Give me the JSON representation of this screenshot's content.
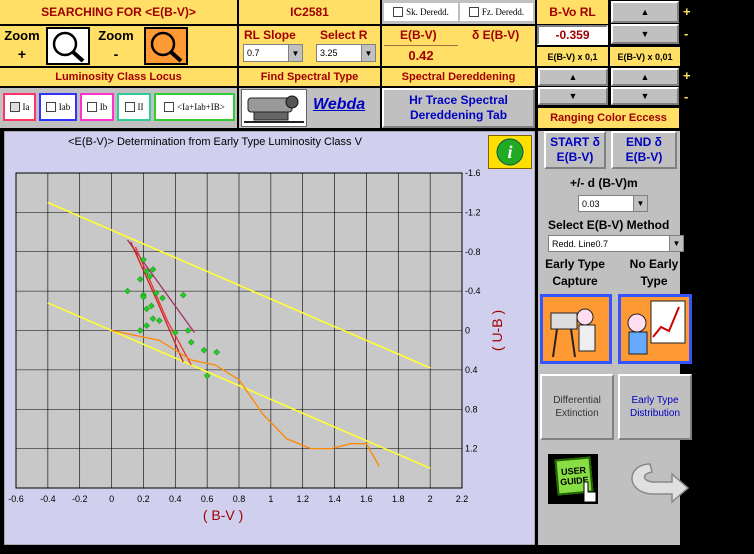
{
  "header": {
    "searching_for": "SEARCHING FOR  <E(B-V)>",
    "cluster": "IC2581",
    "sk_deredd": "Sk. Deredd.",
    "fz_deredd": "Fz. Deredd.",
    "bvo_rl": "B-Vo RL"
  },
  "zoom": {
    "zoom_plus_label": "Zoom",
    "zoom_plus_sign": "+",
    "zoom_minus_label": "Zoom",
    "zoom_minus_sign": "-"
  },
  "rl": {
    "slope_label": "RL Slope",
    "select_r_label": "Select R",
    "slope_value": "0.7",
    "r_value": "3.25"
  },
  "ebv": {
    "label": "E(B-V)",
    "delta_label": "δ E(B-V)",
    "value": "0.42",
    "bvo_value": "-0.359",
    "x01": "E(B-V) x 0,1",
    "x001": "E(B-V) x 0,01"
  },
  "sections": {
    "lum_locus": "Luminosity Class Locus",
    "find_spec": "Find Spectral Type",
    "spec_dered": "Spectral Dereddening",
    "ranging": "Ranging Color Eccess"
  },
  "lum_classes": [
    "Ia",
    "Iab",
    "Ib",
    "II",
    "<Ia+Iab+IB>"
  ],
  "webda": "Webda",
  "hr_trace": "Hr Trace Spectral Dereddening Tab",
  "start_btn": "START δ E(B-V)",
  "end_btn": "END δ E(B-V)",
  "pm_label": "+/- d (B-V)m",
  "pm_value": "0.03",
  "method_label": "Select E(B-V) Method",
  "method_value": "Redd. Line0.7",
  "early_capture": "Early Type Capture",
  "no_early": "No Early Type",
  "differential": "Differential Extinction",
  "early_dist": "Early Type Distribution",
  "user_guide": "USER GUIDE",
  "signs": {
    "plus": "+",
    "minus": "-"
  },
  "chart_data": {
    "type": "scatter",
    "title": "<E(B-V)> Determination from Early Type Luminosity Class V",
    "xlabel": "( B-V )",
    "ylabel": "( U-B )",
    "xlim": [
      -0.6,
      2.2
    ],
    "ylim": [
      1.6,
      -1.6
    ],
    "y_inverted": true,
    "xticks": [
      -0.6,
      -0.4,
      -0.2,
      0,
      0.2,
      0.4,
      0.6,
      0.8,
      1,
      1.2,
      1.4,
      1.6,
      1.8,
      2,
      2.2
    ],
    "yticks": [
      -1.6,
      -1.2,
      -0.8,
      -0.4,
      0,
      0.4,
      0.8,
      1.2
    ],
    "grid": true,
    "points": [
      [
        0.2,
        -0.72
      ],
      [
        0.22,
        -0.6
      ],
      [
        0.24,
        -0.55
      ],
      [
        0.18,
        -0.52
      ],
      [
        0.26,
        -0.62
      ],
      [
        0.1,
        -0.4
      ],
      [
        0.2,
        -0.36
      ],
      [
        0.28,
        -0.38
      ],
      [
        0.32,
        -0.33
      ],
      [
        0.45,
        -0.36
      ],
      [
        0.22,
        -0.22
      ],
      [
        0.26,
        -0.12
      ],
      [
        0.3,
        -0.1
      ],
      [
        0.22,
        -0.05
      ],
      [
        0.18,
        0.0
      ],
      [
        0.4,
        0.02
      ],
      [
        0.48,
        0.0
      ],
      [
        0.5,
        0.12
      ],
      [
        0.58,
        0.2
      ],
      [
        0.66,
        0.22
      ],
      [
        0.6,
        0.46
      ],
      [
        0.2,
        -0.34
      ],
      [
        0.25,
        -0.25
      ]
    ],
    "lines": [
      {
        "color": "#ffff33",
        "points": [
          [
            -0.4,
            -1.3
          ],
          [
            2.0,
            0.38
          ]
        ]
      },
      {
        "color": "#ffff33",
        "points": [
          [
            -0.4,
            -0.28
          ],
          [
            2.0,
            1.4
          ]
        ]
      },
      {
        "color": "#a0306a",
        "points": [
          [
            0.1,
            -0.92
          ],
          [
            0.52,
            0.02
          ]
        ]
      },
      {
        "color": "#cc2222",
        "points": [
          [
            0.12,
            -0.9
          ],
          [
            0.28,
            -0.32
          ],
          [
            0.45,
            0.32
          ]
        ]
      },
      {
        "color": "#ee3333",
        "points": [
          [
            0.15,
            -0.85
          ],
          [
            0.35,
            -0.1
          ],
          [
            0.5,
            0.35
          ]
        ]
      },
      {
        "color": "#ff8800",
        "points": [
          [
            -0.0,
            -0.0
          ],
          [
            0.3,
            0.1
          ],
          [
            0.5,
            0.3
          ],
          [
            0.65,
            0.35
          ],
          [
            0.8,
            0.5
          ],
          [
            0.95,
            0.85
          ],
          [
            1.1,
            1.1
          ],
          [
            1.25,
            1.2
          ],
          [
            1.38,
            1.2
          ],
          [
            1.5,
            1.15
          ],
          [
            1.6,
            1.15
          ],
          [
            1.68,
            1.38
          ]
        ]
      }
    ]
  }
}
